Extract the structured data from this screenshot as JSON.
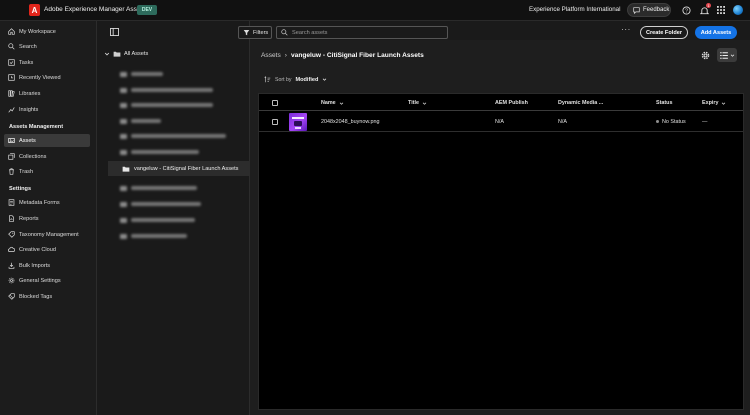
{
  "header": {
    "app_title": "Adobe Experience Manager Assets",
    "env_badge": "DEV",
    "org_name": "Experience Platform International",
    "feedback_label": "Feedback",
    "notification_count": "1"
  },
  "nav": {
    "items": [
      {
        "label": "My Workspace",
        "icon": "home-icon"
      },
      {
        "label": "Search",
        "icon": "search-icon"
      },
      {
        "label": "Tasks",
        "icon": "tasks-icon"
      },
      {
        "label": "Recently Viewed",
        "icon": "clock-icon"
      },
      {
        "label": "Libraries",
        "icon": "library-icon"
      },
      {
        "label": "Insights",
        "icon": "insights-icon"
      }
    ],
    "section_assets": "Assets Management",
    "assets_items": [
      {
        "label": "Assets",
        "icon": "assets-icon",
        "active": true
      },
      {
        "label": "Collections",
        "icon": "collections-icon"
      },
      {
        "label": "Trash",
        "icon": "trash-icon"
      }
    ],
    "section_settings": "Settings",
    "settings_items": [
      {
        "label": "Metadata Forms",
        "icon": "form-icon"
      },
      {
        "label": "Reports",
        "icon": "reports-icon"
      },
      {
        "label": "Taxonomy Management",
        "icon": "taxonomy-icon"
      },
      {
        "label": "Creative Cloud",
        "icon": "creative-cloud-icon"
      },
      {
        "label": "Bulk Imports",
        "icon": "import-icon"
      },
      {
        "label": "General Settings",
        "icon": "gear-icon"
      },
      {
        "label": "Blocked Tags",
        "icon": "blocked-tag-icon"
      }
    ]
  },
  "toolbar": {
    "filters_label": "Filters",
    "search_placeholder": "Search assets",
    "create_folder_label": "Create Folder",
    "add_assets_label": "Add Assets"
  },
  "tree": {
    "root_label": "All Assets",
    "selected_folder": "vangeluw - CitiSignal Fiber Launch Assets"
  },
  "breadcrumb": {
    "root": "Assets",
    "current": "vangeluw - CitiSignal Fiber Launch Assets"
  },
  "sort": {
    "label": "Sort by",
    "value": "Modified"
  },
  "table": {
    "columns": [
      "Name",
      "Title",
      "AEM Publish",
      "Dynamic Media ...",
      "Status",
      "Expiry"
    ],
    "rows": [
      {
        "name": "2048x2048_buynow.png",
        "title": "",
        "aem_publish": "N/A",
        "dynamic_media": "N/A",
        "status": "No Status",
        "expiry": "—"
      }
    ]
  }
}
